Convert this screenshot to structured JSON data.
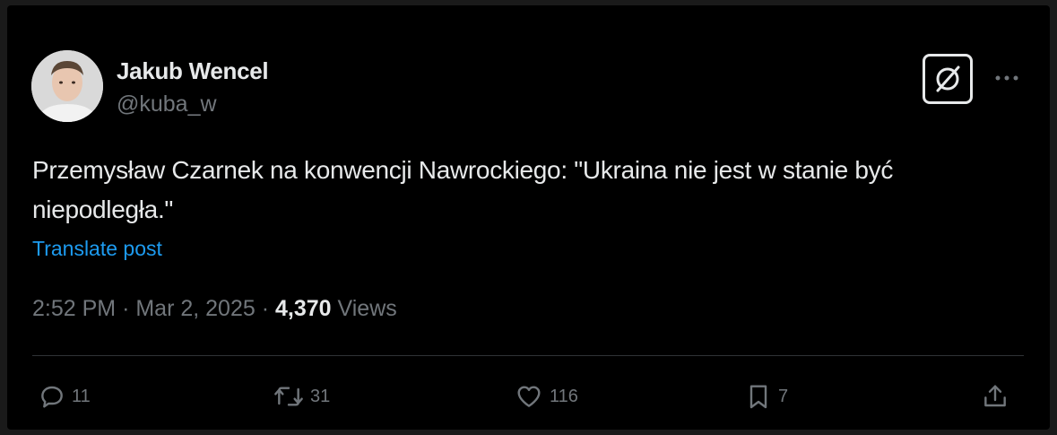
{
  "author": {
    "name": "Jakub Wencel",
    "handle": "@kuba_w"
  },
  "header_actions": {
    "grok_icon": "grok-icon",
    "more_icon": "more-dots-icon"
  },
  "post": {
    "text": "Przemysław Czarnek na konwencji Nawrockiego: \"Ukraina nie jest w stanie być niepodległa.\"",
    "translate_label": "Translate post",
    "time": "2:52 PM",
    "separator": "·",
    "date": "Mar 2, 2025",
    "views_count": "4,370",
    "views_label": "Views"
  },
  "actions": {
    "replies": "11",
    "reposts": "31",
    "likes": "116",
    "bookmarks": "7"
  },
  "colors": {
    "background": "#000000",
    "text": "#e7e9ea",
    "secondary": "#71767b",
    "link": "#1d9bf0"
  }
}
